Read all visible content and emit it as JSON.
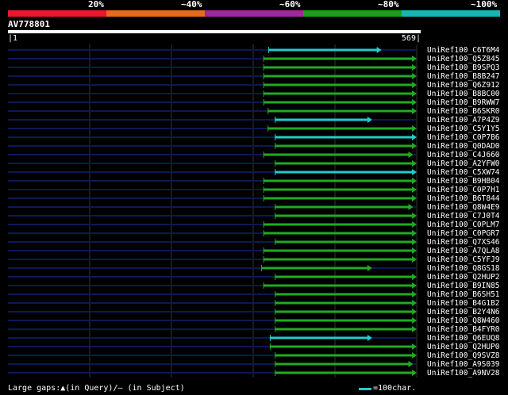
{
  "identity_scale": {
    "labels": [
      "20%",
      "~40%",
      "~60%",
      "~80%",
      "~100%"
    ],
    "colors": [
      "#e8192c",
      "#e86a1a",
      "#a0289c",
      "#1aa01a",
      "#1ab4b4"
    ]
  },
  "query": {
    "id": "AV778801",
    "start": "1",
    "end": "569",
    "length": 569
  },
  "hits": [
    {
      "id": "UniRef100_C6T6M4",
      "start": 363,
      "end": 520,
      "color": "#22cccc"
    },
    {
      "id": "UniRef100_Q5Z845",
      "start": 356,
      "end": 569,
      "color": "#22aa22"
    },
    {
      "id": "UniRef100_B9SPQ3",
      "start": 356,
      "end": 569,
      "color": "#22aa22"
    },
    {
      "id": "UniRef100_B8B247",
      "start": 356,
      "end": 569,
      "color": "#22aa22"
    },
    {
      "id": "UniRef100_Q6Z912",
      "start": 356,
      "end": 569,
      "color": "#22aa22"
    },
    {
      "id": "UniRef100_B8BC00",
      "start": 356,
      "end": 569,
      "color": "#22aa22"
    },
    {
      "id": "UniRef100_B9RWW7",
      "start": 356,
      "end": 569,
      "color": "#22aa22"
    },
    {
      "id": "UniRef100_B6SKR0",
      "start": 362,
      "end": 569,
      "color": "#22aa22"
    },
    {
      "id": "UniRef100_A7P4Z9",
      "start": 372,
      "end": 507,
      "color": "#22cccc"
    },
    {
      "id": "UniRef100_C5Y1Y5",
      "start": 362,
      "end": 569,
      "color": "#22aa22"
    },
    {
      "id": "UniRef100_C0P7B6",
      "start": 372,
      "end": 569,
      "color": "#22cccc"
    },
    {
      "id": "UniRef100_Q0DAD0",
      "start": 372,
      "end": 569,
      "color": "#22aa22"
    },
    {
      "id": "UniRef100_C4J660",
      "start": 356,
      "end": 564,
      "color": "#22aa22"
    },
    {
      "id": "UniRef100_A2YFW0",
      "start": 372,
      "end": 569,
      "color": "#22aa22"
    },
    {
      "id": "UniRef100_C5XW74",
      "start": 372,
      "end": 569,
      "color": "#22cccc"
    },
    {
      "id": "UniRef100_B9HB04",
      "start": 356,
      "end": 569,
      "color": "#22aa22"
    },
    {
      "id": "UniRef100_C0P7H1",
      "start": 356,
      "end": 569,
      "color": "#22aa22"
    },
    {
      "id": "UniRef100_B6T844",
      "start": 356,
      "end": 569,
      "color": "#22aa22"
    },
    {
      "id": "UniRef100_Q8W4E9",
      "start": 372,
      "end": 564,
      "color": "#22aa22"
    },
    {
      "id": "UniRef100_C7J0T4",
      "start": 372,
      "end": 569,
      "color": "#22aa22"
    },
    {
      "id": "UniRef100_C0PLM7",
      "start": 356,
      "end": 569,
      "color": "#22aa22"
    },
    {
      "id": "UniRef100_C0PGR7",
      "start": 356,
      "end": 569,
      "color": "#22aa22"
    },
    {
      "id": "UniRef100_Q7XS46",
      "start": 372,
      "end": 569,
      "color": "#22aa22"
    },
    {
      "id": "UniRef100_A7QLA8",
      "start": 356,
      "end": 569,
      "color": "#22aa22"
    },
    {
      "id": "UniRef100_C5YFJ9",
      "start": 356,
      "end": 569,
      "color": "#22aa22"
    },
    {
      "id": "UniRef100_Q8GS18",
      "start": 353,
      "end": 507,
      "color": "#22aa22"
    },
    {
      "id": "UniRef100_Q2HUP2",
      "start": 372,
      "end": 569,
      "color": "#22aa22"
    },
    {
      "id": "UniRef100_B9IN85",
      "start": 356,
      "end": 569,
      "color": "#22aa22"
    },
    {
      "id": "UniRef100_B6SH51",
      "start": 372,
      "end": 569,
      "color": "#22aa22"
    },
    {
      "id": "UniRef100_B4G1B2",
      "start": 372,
      "end": 569,
      "color": "#22aa22"
    },
    {
      "id": "UniRef100_B2Y4N6",
      "start": 372,
      "end": 569,
      "color": "#22aa22"
    },
    {
      "id": "UniRef100_Q8W460",
      "start": 372,
      "end": 569,
      "color": "#22aa22"
    },
    {
      "id": "UniRef100_B4FYR0",
      "start": 372,
      "end": 569,
      "color": "#22aa22"
    },
    {
      "id": "UniRef100_Q6EUQ8",
      "start": 365,
      "end": 507,
      "color": "#22cccc"
    },
    {
      "id": "UniRef100_Q2HUP0",
      "start": 365,
      "end": 569,
      "color": "#22aa22"
    },
    {
      "id": "UniRef100_Q9SVZ8",
      "start": 372,
      "end": 569,
      "color": "#22aa22"
    },
    {
      "id": "UniRef100_A9S039",
      "start": 372,
      "end": 564,
      "color": "#22aa22"
    },
    {
      "id": "UniRef100_A9NV28",
      "start": 372,
      "end": 569,
      "color": "#22aa22"
    }
  ],
  "footer": {
    "gaps_text": "Large gaps:▲(in Query)/– (in Subject)",
    "legend_text": "=100char.",
    "legend_color": "#22cccc"
  }
}
